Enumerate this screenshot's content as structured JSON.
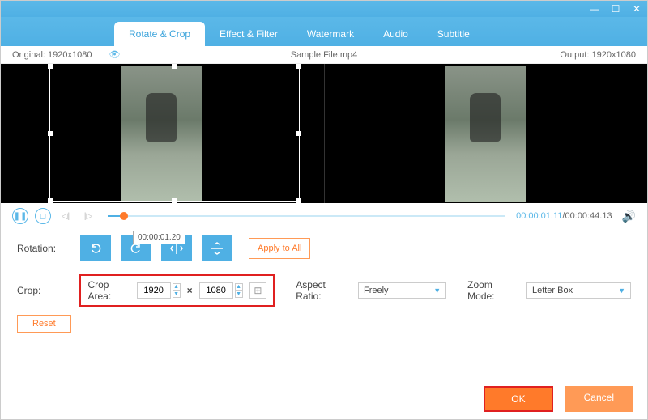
{
  "window": {
    "minimize": "—",
    "maximize": "☐",
    "close": "✕"
  },
  "tabs": {
    "rotate_crop": "Rotate & Crop",
    "effect_filter": "Effect & Filter",
    "watermark": "Watermark",
    "audio": "Audio",
    "subtitle": "Subtitle"
  },
  "info": {
    "original_label": "Original:",
    "original_res": "1920x1080",
    "filename": "Sample File.mp4",
    "output_label": "Output:",
    "output_res": "1920x1080"
  },
  "playback": {
    "current": "00:00:01.11",
    "duration": "/00:00:44.13",
    "tooltip": "00:00:01.20"
  },
  "rotation": {
    "label": "Rotation:",
    "apply_all": "Apply to All"
  },
  "crop": {
    "label": "Crop:",
    "area_label": "Crop Area:",
    "width": "1920",
    "height": "1080",
    "x_sep": "×",
    "aspect_label": "Aspect Ratio:",
    "aspect_value": "Freely",
    "zoom_label": "Zoom Mode:",
    "zoom_value": "Letter Box",
    "reset": "Reset"
  },
  "footer": {
    "ok": "OK",
    "cancel": "Cancel"
  }
}
